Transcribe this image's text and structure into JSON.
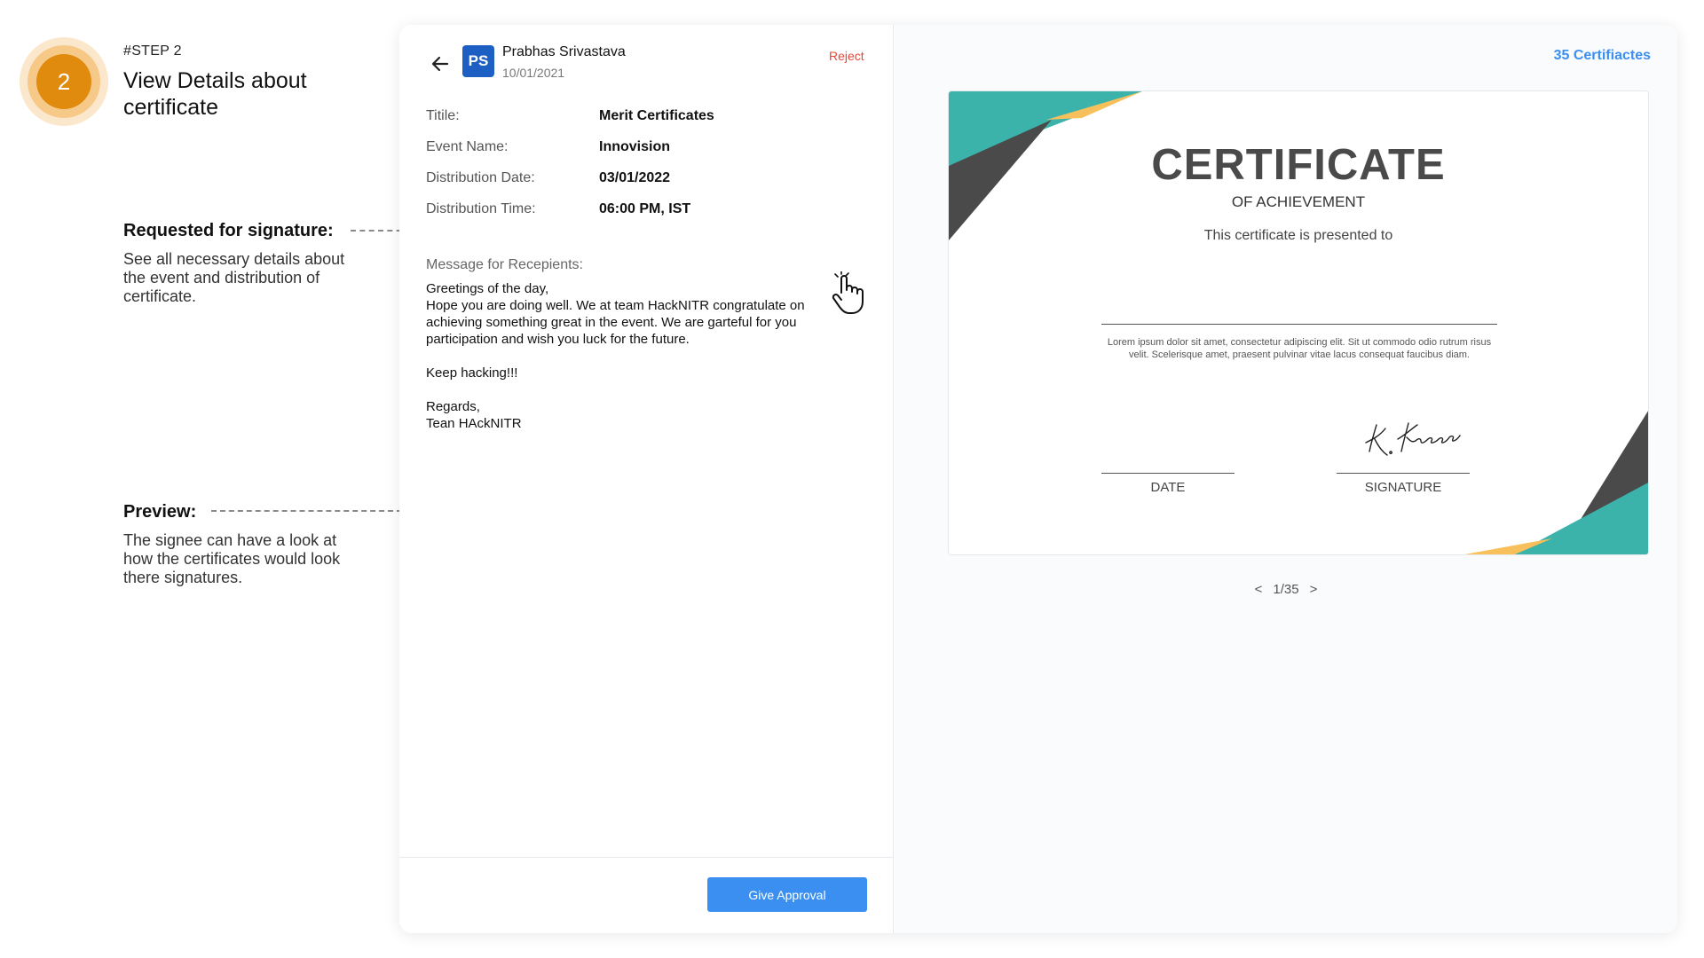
{
  "step": {
    "number": "2",
    "tag": "#STEP 2",
    "title": "View Details about certificate"
  },
  "annotations": [
    {
      "heading": "Requested for signature:",
      "body": "See all necessary details about the event and distribution of certificate."
    },
    {
      "heading": "Preview:",
      "body": "The signee can have a look at how the certificates would look there signatures."
    }
  ],
  "request": {
    "avatar_initials": "PS",
    "sender_name": "Prabhas Srivastava",
    "sender_date": "10/01/2021",
    "reject_label": "Reject",
    "details": [
      {
        "label": "Titile:",
        "value": "Merit Certificates"
      },
      {
        "label": "Event Name:",
        "value": "Innovision"
      },
      {
        "label": "Distribution Date:",
        "value": "03/01/2022"
      },
      {
        "label": "Distribution Time:",
        "value": "06:00 PM, IST"
      }
    ],
    "message_label": "Message for Recepients:",
    "message_lines": [
      "Greetings of the day,",
      "Hope you are doing well. We at team HackNITR congratulate on",
      "achieving something great in the event. We are garteful for you",
      "participation and wish you luck for the future.",
      "Keep hacking!!!",
      "Regards,",
      "Tean HAckNITR"
    ],
    "approve_label": "Give Approval"
  },
  "preview": {
    "count_label": "35 Certifiactes",
    "certificate": {
      "title": "CERTIFICATE",
      "subtitle": "OF ACHIEVEMENT",
      "presented_to": "This certificate is presented to",
      "lorem": "Lorem ipsum dolor sit amet, consectetur adipiscing elit. Sit ut commodo odio rutrum risus velit. Scelerisque amet, praesent pulvinar vitae lacus consequat faucibus diam.",
      "date_label": "DATE",
      "signature_label": "SIGNATURE",
      "signature_text": "K. Kapoor"
    },
    "pager": {
      "prev": "<",
      "position": "1/35",
      "next": ">"
    }
  },
  "colors": {
    "accent_blue": "#3a8ff0",
    "avatar_blue": "#1d5fc2",
    "reject_red": "#e04a3a",
    "step_orange": "#e08a0e",
    "cert_teal": "#3bb3aa",
    "cert_dark": "#4a4a4a",
    "cert_yellow": "#f8c05a"
  }
}
